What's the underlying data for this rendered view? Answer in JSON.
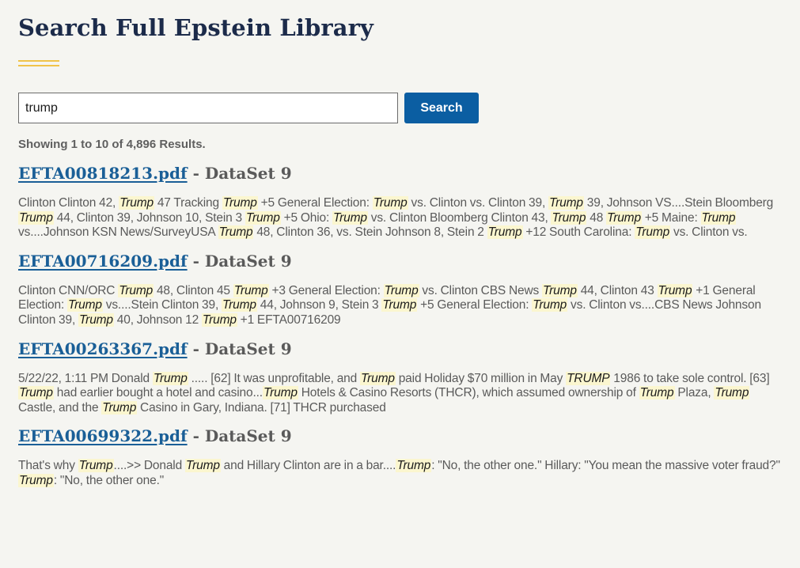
{
  "page": {
    "title": "Search Full Epstein Library"
  },
  "search": {
    "query": "trump",
    "button_label": "Search"
  },
  "results_summary": "Showing 1 to 10 of 4,896 Results.",
  "results": [
    {
      "file": "EFTA00818213.pdf",
      "separator": " - ",
      "dataset": "DataSet 9",
      "snippet": [
        {
          "t": "Clinton Clinton 42, "
        },
        {
          "t": "Trump",
          "hl": true
        },
        {
          "t": " 47 Tracking "
        },
        {
          "t": "Trump",
          "hl": true
        },
        {
          "t": " +5 General Election: "
        },
        {
          "t": "Trump",
          "hl": true
        },
        {
          "t": " vs. Clinton vs. Clinton 39, "
        },
        {
          "t": "Trump",
          "hl": true
        },
        {
          "t": " 39, Johnson VS....Stein Bloomberg "
        },
        {
          "t": "Trump",
          "hl": true
        },
        {
          "t": " 44, Clinton 39, Johnson 10, Stein 3 "
        },
        {
          "t": "Trump",
          "hl": true
        },
        {
          "t": " +5 Ohio: "
        },
        {
          "t": "Trump",
          "hl": true
        },
        {
          "t": " vs. Clinton Bloomberg Clinton 43, "
        },
        {
          "t": "Trump",
          "hl": true
        },
        {
          "t": " 48 "
        },
        {
          "t": "Trump",
          "hl": true
        },
        {
          "t": " +5 Maine: "
        },
        {
          "t": "Trump",
          "hl": true
        },
        {
          "t": " vs....Johnson KSN News/SurveyUSA "
        },
        {
          "t": "Trump",
          "hl": true
        },
        {
          "t": " 48, Clinton 36, vs. Stein Johnson 8, Stein 2 "
        },
        {
          "t": "Trump",
          "hl": true
        },
        {
          "t": " +12 South Carolina: "
        },
        {
          "t": "Trump",
          "hl": true
        },
        {
          "t": " vs. Clinton vs."
        }
      ]
    },
    {
      "file": "EFTA00716209.pdf",
      "separator": " - ",
      "dataset": "DataSet 9",
      "snippet": [
        {
          "t": "Clinton CNN/ORC "
        },
        {
          "t": "Trump",
          "hl": true
        },
        {
          "t": " 48, Clinton 45 "
        },
        {
          "t": "Trump",
          "hl": true
        },
        {
          "t": " +3 General Election: "
        },
        {
          "t": "Trump",
          "hl": true
        },
        {
          "t": " vs. Clinton CBS News "
        },
        {
          "t": "Trump",
          "hl": true
        },
        {
          "t": " 44, Clinton 43 "
        },
        {
          "t": "Trump",
          "hl": true
        },
        {
          "t": " +1 General Election: "
        },
        {
          "t": "Trump",
          "hl": true
        },
        {
          "t": " vs....Stein Clinton 39, "
        },
        {
          "t": "Trump",
          "hl": true
        },
        {
          "t": " 44, Johnson 9, Stein 3 "
        },
        {
          "t": "Trump",
          "hl": true
        },
        {
          "t": " +5 General Election: "
        },
        {
          "t": "Trump",
          "hl": true
        },
        {
          "t": " vs. Clinton vs....CBS News Johnson Clinton 39, "
        },
        {
          "t": "Trump",
          "hl": true
        },
        {
          "t": " 40, Johnson 12 "
        },
        {
          "t": "Trump",
          "hl": true
        },
        {
          "t": " +1 EFTA00716209"
        }
      ]
    },
    {
      "file": "EFTA00263367.pdf",
      "separator": " - ",
      "dataset": "DataSet 9",
      "snippet": [
        {
          "t": "5/22/22, 1:11 PM Donald "
        },
        {
          "t": "Trump",
          "hl": true
        },
        {
          "t": " ..... [62] It was unprofitable, and "
        },
        {
          "t": "Trump",
          "hl": true
        },
        {
          "t": " paid Holiday $70 million in May "
        },
        {
          "t": "TRUMP",
          "hl": true
        },
        {
          "t": " 1986 to take sole control. [63] "
        },
        {
          "t": "Trump",
          "hl": true
        },
        {
          "t": " had earlier bought a hotel and casino..."
        },
        {
          "t": "Trump",
          "hl": true
        },
        {
          "t": " Hotels & Casino Resorts (THCR), which assumed ownership of "
        },
        {
          "t": "Trump",
          "hl": true
        },
        {
          "t": " Plaza, "
        },
        {
          "t": "Trump",
          "hl": true
        },
        {
          "t": " Castle, and the "
        },
        {
          "t": "Trump",
          "hl": true
        },
        {
          "t": " Casino in Gary, Indiana. [71] THCR purchased"
        }
      ]
    },
    {
      "file": "EFTA00699322.pdf",
      "separator": " - ",
      "dataset": "DataSet 9",
      "snippet": [
        {
          "t": "That's why "
        },
        {
          "t": "Trump",
          "hl": true
        },
        {
          "t": "....>> Donald "
        },
        {
          "t": "Trump",
          "hl": true
        },
        {
          "t": " and Hillary Clinton are in a bar...."
        },
        {
          "t": "Trump",
          "hl": true
        },
        {
          "t": ": \"No, the other one.\" Hillary: \"You mean the massive voter fraud?\" "
        },
        {
          "t": "Trump",
          "hl": true
        },
        {
          "t": ": \"No, the other one.\""
        }
      ]
    }
  ],
  "colors": {
    "background": "#f5f5f1",
    "title": "#1c2b4a",
    "accent_rule": "#f0c34a",
    "button": "#0b5ea2",
    "link": "#1a5f97",
    "highlight": "#fbf6cf"
  }
}
